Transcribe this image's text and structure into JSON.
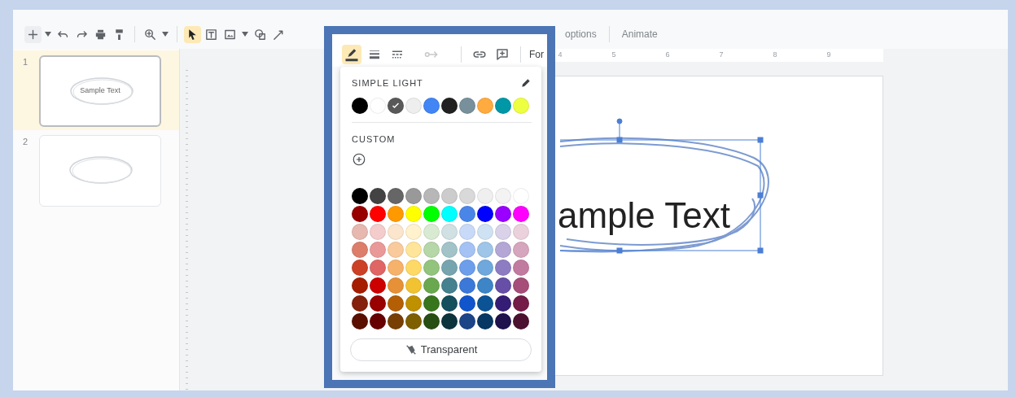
{
  "toolbar": {
    "tools": [
      {
        "kind": "new-slide",
        "selected": false
      },
      {
        "kind": "caret",
        "selected": false
      },
      {
        "kind": "undo",
        "selected": false
      },
      {
        "kind": "redo",
        "selected": false
      },
      {
        "kind": "print",
        "selected": false
      },
      {
        "kind": "paint-format",
        "selected": false
      },
      {
        "kind": "zoom",
        "selected": false
      },
      {
        "kind": "caret",
        "selected": false
      },
      {
        "kind": "select",
        "selected": true
      },
      {
        "kind": "textbox",
        "selected": false
      },
      {
        "kind": "image",
        "selected": false
      },
      {
        "kind": "caret",
        "selected": false
      },
      {
        "kind": "shape",
        "selected": false
      },
      {
        "kind": "line",
        "selected": false
      }
    ],
    "highlighted_tools": [
      {
        "kind": "border-color",
        "selected": true,
        "disabled": false
      },
      {
        "kind": "border-weight",
        "selected": false,
        "disabled": false
      },
      {
        "kind": "border-dash",
        "selected": false,
        "disabled": false
      },
      {
        "kind": "line-ends",
        "selected": false,
        "disabled": true
      },
      {
        "kind": "link",
        "selected": false,
        "disabled": false
      },
      {
        "kind": "comment",
        "selected": false,
        "disabled": false
      }
    ],
    "highlighted_text": "For",
    "menu_items": [
      "options",
      "Animate"
    ]
  },
  "slides": [
    {
      "number": "1",
      "text": "Sample Text",
      "selected": true
    },
    {
      "number": "2",
      "selected": false
    }
  ],
  "ruler": {
    "marks": [
      "4",
      "5",
      "6",
      "7",
      "8",
      "9"
    ]
  },
  "slide": {
    "text": "ample Text"
  },
  "color_menu": {
    "theme_title": "SIMPLE LIGHT",
    "theme_colors": [
      {
        "color": "#000000",
        "selected": false
      },
      {
        "color": "#ffffff",
        "selected": false
      },
      {
        "color": "#595959",
        "selected": true
      },
      {
        "color": "#eeeeee",
        "selected": false
      },
      {
        "color": "#4285f4",
        "selected": false
      },
      {
        "color": "#212121",
        "selected": false
      },
      {
        "color": "#78909c",
        "selected": false
      },
      {
        "color": "#ffab40",
        "selected": false
      },
      {
        "color": "#0097a7",
        "selected": false
      },
      {
        "color": "#eeff41",
        "selected": false
      }
    ],
    "custom_title": "CUSTOM",
    "palette": [
      [
        {
          "color": "#000000"
        },
        {
          "color": "#434343"
        },
        {
          "color": "#666666"
        },
        {
          "color": "#999999"
        },
        {
          "color": "#b7b7b7"
        },
        {
          "color": "#cccccc"
        },
        {
          "color": "#d9d9d9"
        },
        {
          "color": "#efefef"
        },
        {
          "color": "#f3f3f3"
        },
        {
          "color": "#ffffff"
        }
      ],
      [
        {
          "color": "#980000"
        },
        {
          "color": "#ff0000"
        },
        {
          "color": "#ff9900"
        },
        {
          "color": "#ffff00"
        },
        {
          "color": "#00ff00"
        },
        {
          "color": "#00ffff"
        },
        {
          "color": "#4a86e8"
        },
        {
          "color": "#0000ff"
        },
        {
          "color": "#9900ff"
        },
        {
          "color": "#ff00ff"
        }
      ],
      [
        {
          "color": "#e6b8af"
        },
        {
          "color": "#f4cccc"
        },
        {
          "color": "#fce5cd"
        },
        {
          "color": "#fff2cc"
        },
        {
          "color": "#d9ead3"
        },
        {
          "color": "#d0e0e3"
        },
        {
          "color": "#c9daf8"
        },
        {
          "color": "#cfe2f3"
        },
        {
          "color": "#d9d2e9"
        },
        {
          "color": "#ead1dc"
        }
      ],
      [
        {
          "color": "#dd7e6b"
        },
        {
          "color": "#ea9999"
        },
        {
          "color": "#f9cb9c"
        },
        {
          "color": "#ffe599"
        },
        {
          "color": "#b6d7a8"
        },
        {
          "color": "#a2c4c9"
        },
        {
          "color": "#a4c2f4"
        },
        {
          "color": "#9fc5e8"
        },
        {
          "color": "#b4a7d6"
        },
        {
          "color": "#d5a6bd"
        }
      ],
      [
        {
          "color": "#cc4125"
        },
        {
          "color": "#e06666"
        },
        {
          "color": "#f6b26b"
        },
        {
          "color": "#ffd966"
        },
        {
          "color": "#93c47d"
        },
        {
          "color": "#76a5af"
        },
        {
          "color": "#6d9eeb"
        },
        {
          "color": "#6fa8dc"
        },
        {
          "color": "#8e7cc3"
        },
        {
          "color": "#c27ba0"
        }
      ],
      [
        {
          "color": "#a61c00"
        },
        {
          "color": "#cc0000"
        },
        {
          "color": "#e69138"
        },
        {
          "color": "#f1c232"
        },
        {
          "color": "#6aa84f"
        },
        {
          "color": "#45818e"
        },
        {
          "color": "#3c78d8"
        },
        {
          "color": "#3d85c6"
        },
        {
          "color": "#674ea7"
        },
        {
          "color": "#a64d79"
        }
      ],
      [
        {
          "color": "#85200c"
        },
        {
          "color": "#990000"
        },
        {
          "color": "#b45f06"
        },
        {
          "color": "#bf9000"
        },
        {
          "color": "#38761d"
        },
        {
          "color": "#134f5c"
        },
        {
          "color": "#1155cc"
        },
        {
          "color": "#0b5394"
        },
        {
          "color": "#351c75"
        },
        {
          "color": "#741b47"
        }
      ],
      [
        {
          "color": "#5b0f00"
        },
        {
          "color": "#660000"
        },
        {
          "color": "#783f04"
        },
        {
          "color": "#7f6000"
        },
        {
          "color": "#274e13"
        },
        {
          "color": "#0c343d"
        },
        {
          "color": "#1c4587"
        },
        {
          "color": "#073763"
        },
        {
          "color": "#20124d"
        },
        {
          "color": "#4c1130"
        }
      ]
    ],
    "transparent_button": "Transparent"
  }
}
